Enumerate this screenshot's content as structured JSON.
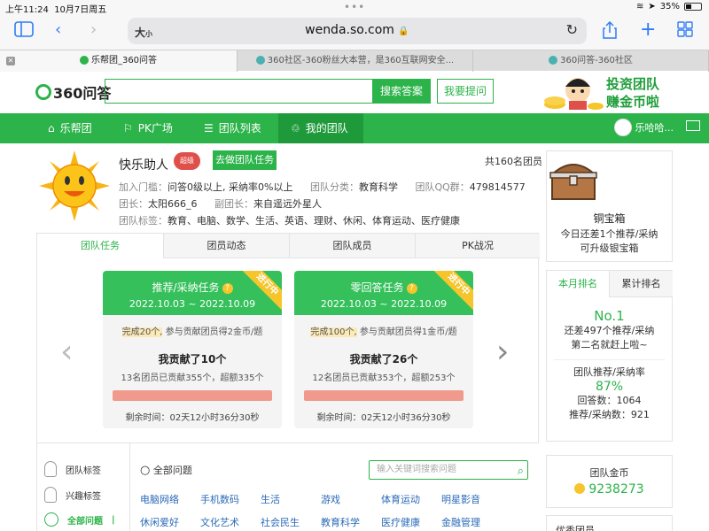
{
  "status": {
    "time": "上午11:24",
    "date": "10月7日周五",
    "battery": "35%",
    "battery_level": 0.35
  },
  "browser": {
    "text_size": "大",
    "text_size_small": "小",
    "host": "wenda.so.com"
  },
  "tabs": [
    {
      "label": "乐帮团_360问答"
    },
    {
      "label": "360社区-360粉丝大本营，是360互联网安全..."
    },
    {
      "label": "360问答-360社区"
    }
  ],
  "header": {
    "logo": "360问答",
    "search_button": "搜索答案",
    "ask_button": "我要提问",
    "banner_line1": "投资团队",
    "banner_line2": "赚金币啦"
  },
  "nav": {
    "items": [
      {
        "label": "乐帮团",
        "icon": "home-icon"
      },
      {
        "label": "PK广场",
        "icon": "flag-icon"
      },
      {
        "label": "团队列表",
        "icon": "list-icon"
      },
      {
        "label": "我的团队",
        "icon": "team-icon"
      }
    ],
    "user": "乐哈哈..."
  },
  "team": {
    "name": "快乐助人",
    "badge": "超级",
    "join_button": "去做团队任务",
    "member_count": "共160名团员",
    "threshold_label": "加入门槛：",
    "threshold": "问答0级以上, 采纳率0%以上",
    "category_label": "团队分类：",
    "category": "教育科学",
    "qq_label": "团队QQ群：",
    "qq": "479814577",
    "leader_label": "团长：",
    "leader": "太阳666_6",
    "vice_label": "副团长：",
    "vice": "来自遥远外星人",
    "tags_label": "团队标签：",
    "tags": "教育、电脑、数学、生活、英语、理财、休闲、体育运动、医疗健康"
  },
  "task_tabs": [
    "团队任务",
    "团员动态",
    "团队成员",
    "PK战况"
  ],
  "cards": [
    {
      "title": "推荐/采纳任务",
      "date": "2022.10.03 ~ 2022.10.09",
      "ribbon": "进行中",
      "done": "完成20个,",
      "desc": "参与贡献团员得2金币/题",
      "contrib": "我贡献了10个",
      "team": "13名团员已贡献355个，超额335个",
      "time": "剩余时间：02天12小时36分30秒"
    },
    {
      "title": "零回答任务",
      "date": "2022.10.03 ~ 2022.10.09",
      "ribbon": "进行中",
      "done": "完成100个,",
      "desc": "参与贡献团员得1金币/题",
      "contrib": "我贡献了26个",
      "team": "12名团员已贡献353个，超额253个",
      "time": "剩余时间：02天12小时36分30秒"
    }
  ],
  "side_list": [
    "团队标签",
    "兴趣标签",
    "全部问题"
  ],
  "questions": {
    "all_label": "全部问题",
    "search_placeholder": "输入关键词搜索问题",
    "categories_row1": [
      "电脑网络",
      "手机数码",
      "生活",
      "游戏",
      "体育运动",
      "明星影音"
    ],
    "categories_row2": [
      "休闲爱好",
      "文化艺术",
      "社会民生",
      "教育科学",
      "医疗健康",
      "金融管理"
    ]
  },
  "chest": {
    "title": "铜宝箱",
    "line1": "今日还差1个推荐/采纳",
    "line2": "可升级银宝箱"
  },
  "rank": {
    "tabs": [
      "本月排名",
      "累计排名"
    ],
    "position": "No.1",
    "line1": "还差497个推荐/采纳",
    "line2": "第二名就赶上啦~",
    "rate_label": "团队推荐/采纳率",
    "rate": "87%",
    "answers": "回答数：1064",
    "adopted": "推荐/采纳数：921"
  },
  "coins": {
    "title": "团队金币",
    "value": "9238273"
  },
  "excellent": {
    "title": "优秀团员"
  }
}
